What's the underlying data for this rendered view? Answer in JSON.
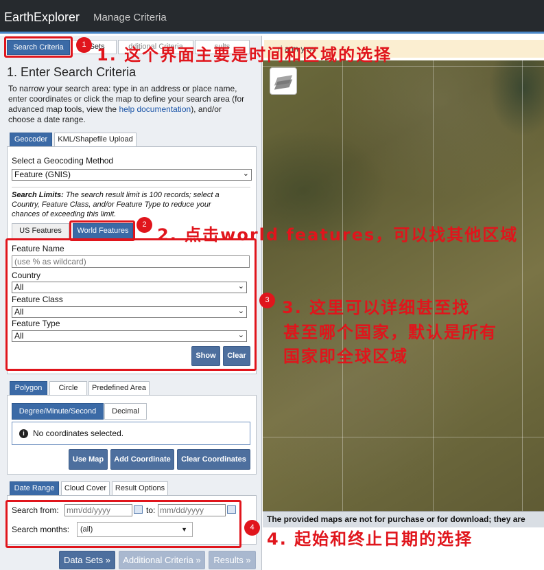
{
  "header": {
    "title": "EarthExplorer",
    "subtitle": "Manage Criteria"
  },
  "tabs": {
    "main": [
      "Search Criteria",
      "Data Sets",
      "Additional Criteria",
      "Results"
    ],
    "main_visible": [
      "Search Criteria",
      "a Sets",
      "dditional Criteria",
      "sults"
    ]
  },
  "section": {
    "title": "1. Enter Search Criteria",
    "intro_1": "To narrow your search area: type in an address or place name,",
    "intro_2": "enter coordinates or click the map to define your search area (for",
    "intro_3": "advanced map tools, view the",
    "intro_link": "help documentation",
    "intro_4": "), and/or",
    "intro_5": "choose a date range."
  },
  "geocoder": {
    "tabs": [
      "Geocoder",
      "KML/Shapefile Upload"
    ],
    "method_label": "Select a Geocoding Method",
    "method_value": "Feature (GNIS)",
    "limits_bold": "Search Limits:",
    "limits_1": "The search result limit is 100 records; select a",
    "limits_2": "Country, Feature Class, and/or Feature Type to reduce your",
    "limits_3": "chances of exceeding this limit.",
    "feature_tabs": [
      "US Features",
      "World Features"
    ],
    "feature_name_label": "Feature Name",
    "feature_name_placeholder": "(use % as wildcard)",
    "country_label": "Country",
    "country_value": "All",
    "class_label": "Feature Class",
    "class_value": "All",
    "type_label": "Feature Type",
    "type_value": "All",
    "show_label": "Show",
    "clear_label": "Clear"
  },
  "polygon": {
    "tabs": [
      "Polygon",
      "Circle",
      "Predefined Area"
    ],
    "format_tabs": [
      "Degree/Minute/Second",
      "Decimal"
    ],
    "info_icon": "info-circle-icon",
    "status": "No coordinates selected.",
    "buttons": [
      "Use Map",
      "Add Coordinate",
      "Clear Coordinates"
    ]
  },
  "date": {
    "tabs": [
      "Date Range",
      "Cloud Cover",
      "Result Options"
    ],
    "from_label": "Search from:",
    "from_placeholder": "mm/dd/yyyy",
    "to_label": "to:",
    "to_placeholder": "mm/dd/yyyy",
    "months_label": "Search months:",
    "months_value": "(all)"
  },
  "footer": {
    "buttons": [
      "Data Sets »",
      "Additional Criteria »",
      "Results »"
    ]
  },
  "map": {
    "layers_icon": "layers-icon",
    "banner": "The provided maps are not for purchase or for download; they are",
    "top_strip": "ri   a  m   y  ov"
  },
  "annotations": {
    "n1": "1",
    "note1": "1. 这个界面主要是时间和区域的选择",
    "n2": "2",
    "note2": "2. 点击world features，可以找其他区域",
    "n3": "3",
    "note3a": "3. 这里可以详细甚至找",
    "note3b": "甚至哪个国家，默认是所有",
    "note3c": "国家即全球区域",
    "n4": "4",
    "note4": "4. 起始和终止日期的选择"
  },
  "colors": {
    "accent": "#3b6aa6",
    "annotation": "#e0151c",
    "header_bg": "#262a2e"
  }
}
